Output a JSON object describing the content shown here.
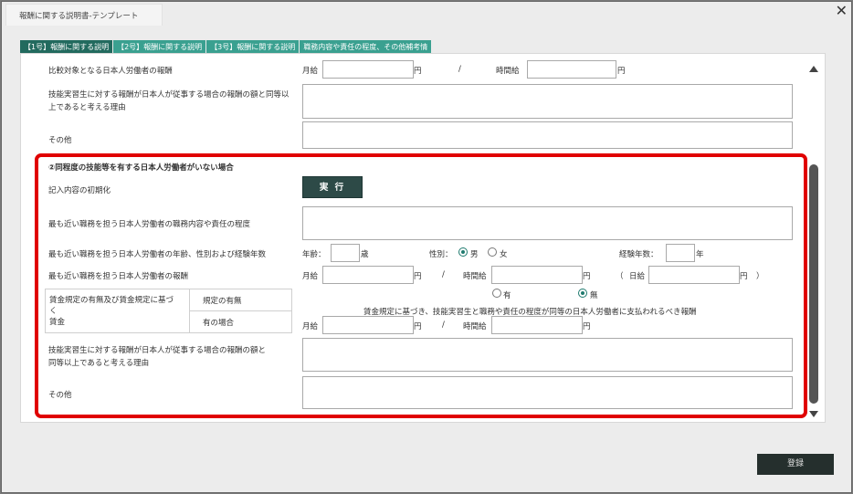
{
  "window": {
    "title": "報酬に関する説明書-テンプレート"
  },
  "tabs": [
    {
      "label": "【1号】報酬に関する説明"
    },
    {
      "label": "【2号】報酬に関する説明"
    },
    {
      "label": "【3号】報酬に関する説明"
    },
    {
      "label": "職務内容や責任の程度、その他補考情"
    }
  ],
  "upper": {
    "comparison_label": "比較対象となる日本人労働者の報酬",
    "monthly_label": "月給",
    "yen": "円",
    "slash": "/",
    "hourly_label": "時間給",
    "reason_label": "技能実習生に対する報酬が日本人が従事する場合の報酬の額と同等以上であると考える理由",
    "other_label": "その他"
  },
  "section2": {
    "heading": "②同程度の技能等を有する日本人労働者がいない場合",
    "init_label": "記入内容の初期化",
    "exec_button": "実 行",
    "duties_label": "最も近い職務を担う日本人労働者の職務内容や責任の程度",
    "age_sex_label": "最も近い職務を担う日本人労働者の年齢、性別および経験年数",
    "age_label": "年齢：",
    "age_unit": "歳",
    "sex_label": "性別：",
    "male": "男",
    "female": "女",
    "exp_label": "経験年数：",
    "exp_unit": "年",
    "wage_label": "最も近い職務を担う日本人労働者の報酬",
    "monthly_label": "月給",
    "yen": "円",
    "slash": "/",
    "hourly_label": "時間給",
    "daily_open": "（",
    "daily_label": "日給",
    "daily_close": "）",
    "rules_label_line1": "賃金規定の有無及び賃金規定に基づ",
    "rules_label_line2": "く",
    "rules_label_line3": "賃金",
    "rules_exist_label": "規定の有無",
    "rules_case_label": "有の場合",
    "has": "有",
    "none": "無",
    "rules_desc": "賃金規定に基づき、技能実習生と職務や責任の程度が同等の日本人労働者に支払われるべき報酬",
    "reason_label_line1": "技能実習生に対する報酬が日本人が従事する場合の報酬の額と",
    "reason_label_line2": "同等以上であると考える理由",
    "other_label": "その他",
    "sex_selected": "男",
    "rules_selected": "無"
  },
  "footer": {
    "register_button": "登録"
  }
}
